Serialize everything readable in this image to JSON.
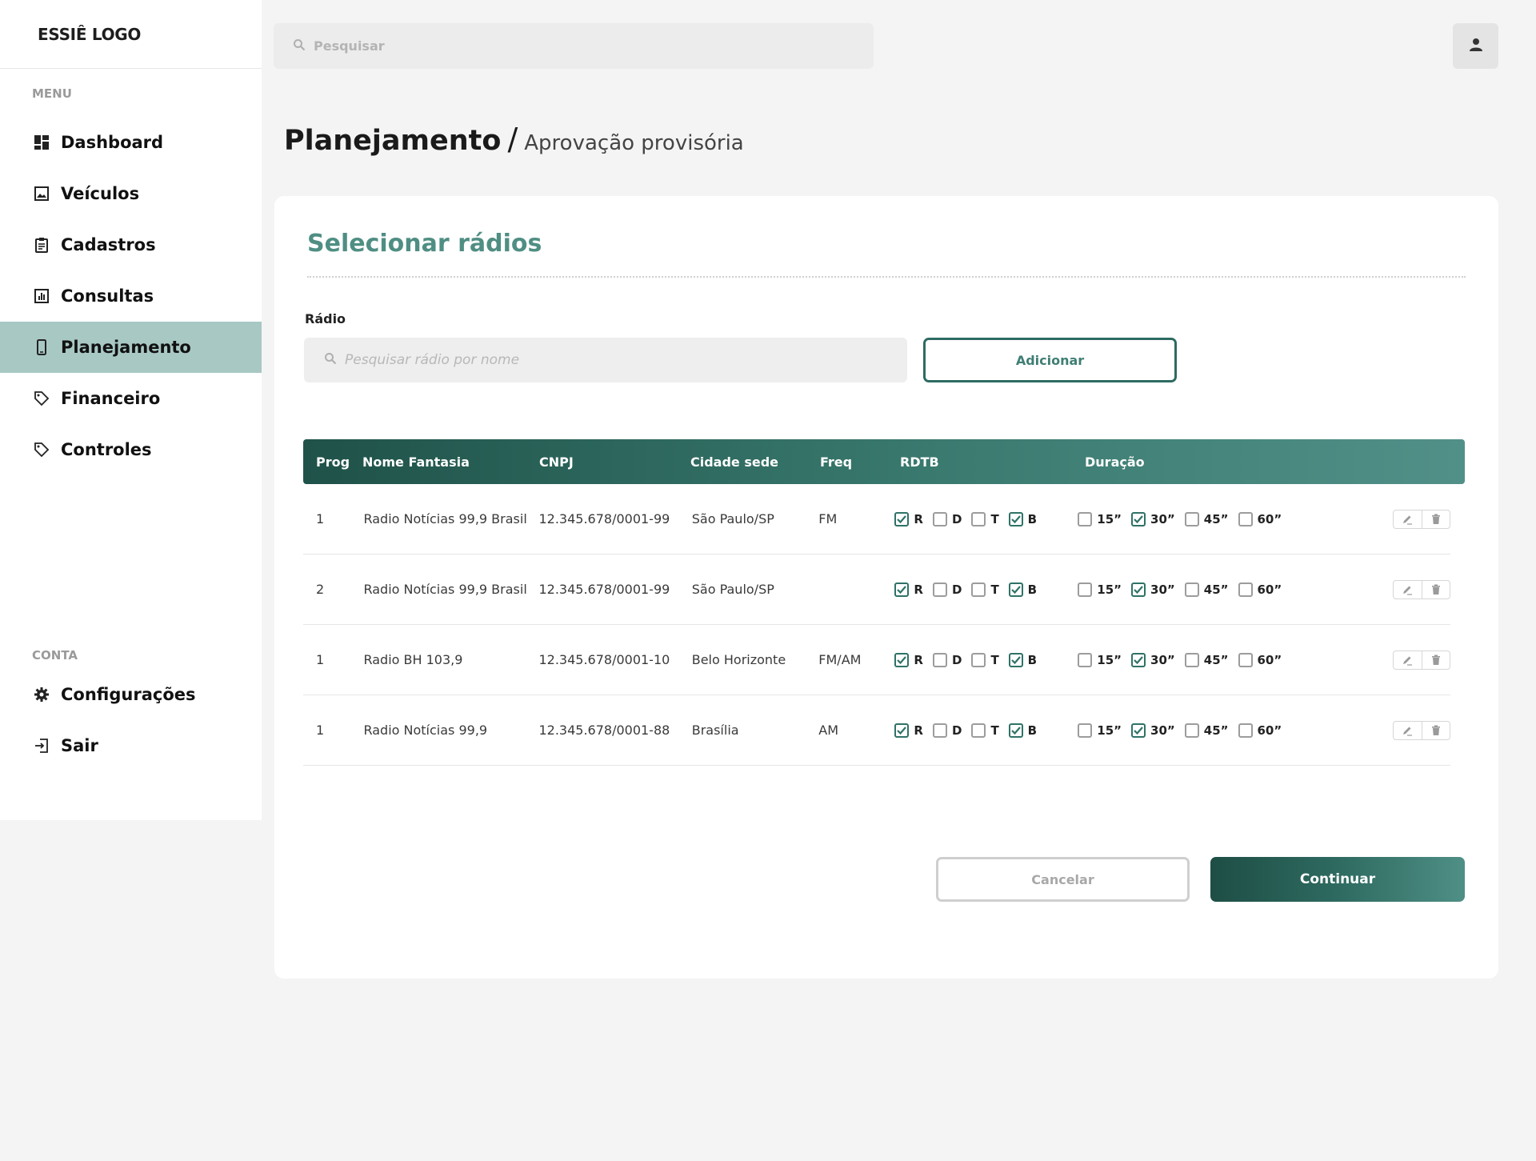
{
  "app": {
    "logo": "ESSIÊ LOGO"
  },
  "topbar": {
    "search_placeholder": "Pesquisar"
  },
  "sidebar": {
    "menu_label": "MENU",
    "items": [
      {
        "label": "Dashboard",
        "icon": "dashboard-icon"
      },
      {
        "label": "Veículos",
        "icon": "image-icon"
      },
      {
        "label": "Cadastros",
        "icon": "clipboard-icon"
      },
      {
        "label": "Consultas",
        "icon": "chart-icon"
      },
      {
        "label": "Planejamento",
        "icon": "phone-icon",
        "active": true
      },
      {
        "label": "Financeiro",
        "icon": "tag-icon"
      },
      {
        "label": "Controles",
        "icon": "tag-icon"
      }
    ],
    "account_label": "CONTA",
    "account_items": [
      {
        "label": "Configurações",
        "icon": "gear-icon"
      },
      {
        "label": "Sair",
        "icon": "logout-icon"
      }
    ]
  },
  "page": {
    "title": "Planejamento",
    "separator": "/",
    "subtitle": "Aprovação provisória"
  },
  "card": {
    "title": "Selecionar rádios",
    "field_label": "Rádio",
    "search_placeholder": "Pesquisar rádio por nome",
    "add_label": "Adicionar",
    "cancel_label": "Cancelar",
    "continue_label": "Continuar"
  },
  "table": {
    "headers": [
      "Prog",
      "Nome Fantasia",
      "CNPJ",
      "Cidade sede",
      "Freq",
      "RDTB",
      "Duração"
    ],
    "rdtb_options": [
      "R",
      "D",
      "T",
      "B"
    ],
    "duration_options": [
      "15”",
      "30”",
      "45”",
      "60”"
    ],
    "rows": [
      {
        "prog": "1",
        "name": "Radio Notícias 99,9 Brasil",
        "cnpj": "12.345.678/0001-99",
        "city": "São Paulo/SP",
        "freq": "FM",
        "rdtb": [
          true,
          false,
          false,
          true
        ],
        "duration": [
          false,
          true,
          false,
          false
        ]
      },
      {
        "prog": "2",
        "name": "Radio Notícias 99,9 Brasil",
        "cnpj": "12.345.678/0001-99",
        "city": "São Paulo/SP",
        "freq": "",
        "rdtb": [
          true,
          false,
          false,
          true
        ],
        "duration": [
          false,
          true,
          false,
          false
        ]
      },
      {
        "prog": "1",
        "name": "Radio BH 103,9",
        "cnpj": "12.345.678/0001-10",
        "city": "Belo Horizonte",
        "freq": "FM/AM",
        "rdtb": [
          true,
          false,
          false,
          true
        ],
        "duration": [
          false,
          true,
          false,
          false
        ]
      },
      {
        "prog": "1",
        "name": "Radio Notícias 99,9",
        "cnpj": "12.345.678/0001-88",
        "city": "Brasília",
        "freq": "AM",
        "rdtb": [
          true,
          false,
          false,
          true
        ],
        "duration": [
          false,
          true,
          false,
          false
        ]
      }
    ]
  },
  "colors": {
    "accent": "#4f8e83",
    "active_nav": "#a8c8c4",
    "header_dark": "#1f5249",
    "header_light": "#519088"
  }
}
